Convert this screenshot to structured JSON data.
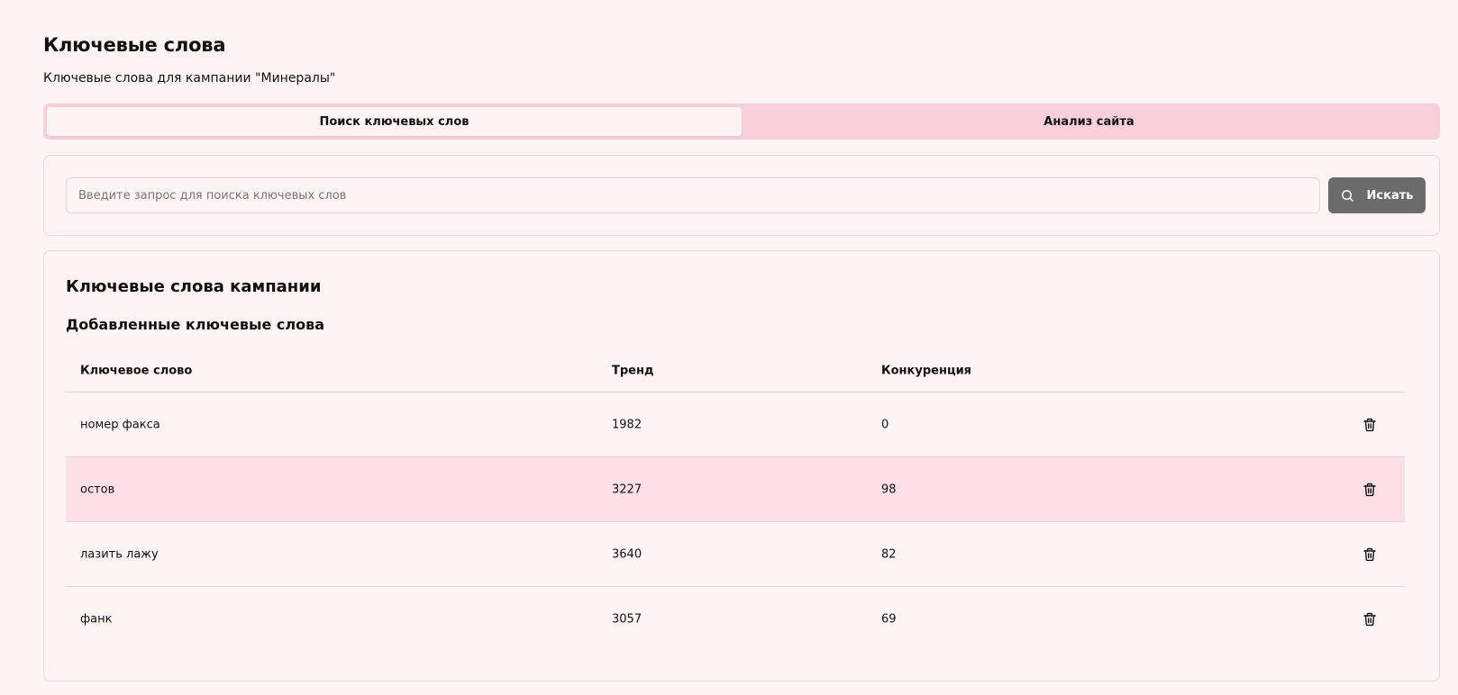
{
  "header": {
    "title": "Ключевые слова",
    "subtitle": "Ключевые слова для кампании \"Минералы\""
  },
  "tabs": [
    {
      "label": "Поиск ключевых слов",
      "active": true
    },
    {
      "label": "Анализ сайта",
      "active": false
    }
  ],
  "search": {
    "placeholder": "Введите запрос для поиска ключевых слов",
    "value": "",
    "button_label": "Искать",
    "button_icon": "search-icon"
  },
  "keywords_section": {
    "title": "Ключевые слова кампании",
    "subtitle": "Добавленные ключевые слова",
    "columns": [
      "Ключевое слово",
      "Тренд",
      "Конкуренция",
      ""
    ],
    "rows": [
      {
        "keyword": "номер факса",
        "trend": "1982",
        "competition": "0",
        "action_icon": "trash-icon"
      },
      {
        "keyword": "остов",
        "trend": "3227",
        "competition": "98",
        "action_icon": "trash-icon"
      },
      {
        "keyword": "лазить лажу",
        "trend": "3640",
        "competition": "82",
        "action_icon": "trash-icon"
      },
      {
        "keyword": "фанк",
        "trend": "3057",
        "competition": "69",
        "action_icon": "trash-icon"
      }
    ]
  },
  "colors": {
    "background": "#fef4f5",
    "tab_bar": "#f9d0da",
    "button": "#6b6b6b",
    "row_highlight": "#fde0e6"
  }
}
